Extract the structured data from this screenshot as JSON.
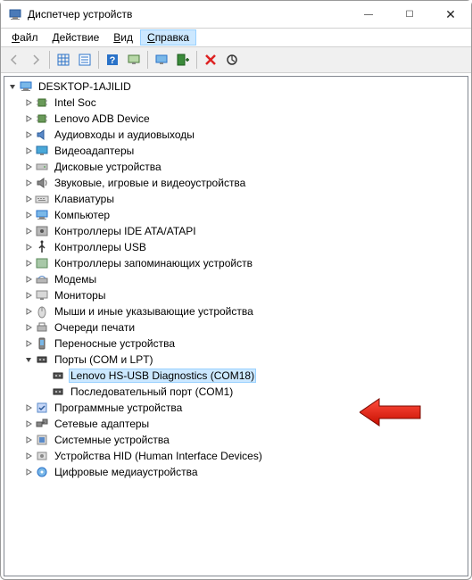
{
  "window": {
    "title": "Диспетчер устройств"
  },
  "menu": {
    "items": [
      {
        "label": "Файл",
        "accel": "Ф"
      },
      {
        "label": "Действие",
        "accel": "Д"
      },
      {
        "label": "Вид",
        "accel": "В"
      },
      {
        "label": "Справка",
        "accel": "С",
        "highlighted": true
      }
    ]
  },
  "toolbar": {
    "buttons": [
      {
        "name": "back-icon",
        "glyph": "arrow-left",
        "disabled": true
      },
      {
        "name": "forward-icon",
        "glyph": "arrow-right",
        "disabled": true
      },
      {
        "sep": true
      },
      {
        "name": "show-hidden-icon",
        "glyph": "grid"
      },
      {
        "name": "properties-icon",
        "glyph": "props"
      },
      {
        "sep": true
      },
      {
        "name": "help-icon",
        "glyph": "help"
      },
      {
        "name": "monitor-icon",
        "glyph": "monitor2"
      },
      {
        "sep": true
      },
      {
        "name": "scan-icon",
        "glyph": "monitor-scan"
      },
      {
        "name": "add-legacy-icon",
        "glyph": "add-hw"
      },
      {
        "sep": true
      },
      {
        "name": "remove-icon",
        "glyph": "red-x"
      },
      {
        "name": "update-icon",
        "glyph": "circle-arrow"
      }
    ]
  },
  "tree": {
    "root": {
      "label": "DESKTOP-1AJILID",
      "icon": "computer",
      "expanded": true
    },
    "categories": [
      {
        "label": "Intel Soc",
        "icon": "chip"
      },
      {
        "label": "Lenovo ADB Device",
        "icon": "chip"
      },
      {
        "label": "Аудиовходы и аудиовыходы",
        "icon": "audio"
      },
      {
        "label": "Видеоадаптеры",
        "icon": "display"
      },
      {
        "label": "Дисковые устройства",
        "icon": "disk"
      },
      {
        "label": "Звуковые, игровые и видеоустройства",
        "icon": "sound"
      },
      {
        "label": "Клавиатуры",
        "icon": "keyboard"
      },
      {
        "label": "Компьютер",
        "icon": "computer"
      },
      {
        "label": "Контроллеры IDE ATA/ATAPI",
        "icon": "ide"
      },
      {
        "label": "Контроллеры USB",
        "icon": "usb"
      },
      {
        "label": "Контроллеры запоминающих устройств",
        "icon": "storage"
      },
      {
        "label": "Модемы",
        "icon": "modem"
      },
      {
        "label": "Мониторы",
        "icon": "monitor"
      },
      {
        "label": "Мыши и иные указывающие устройства",
        "icon": "mouse"
      },
      {
        "label": "Очереди печати",
        "icon": "printer"
      },
      {
        "label": "Переносные устройства",
        "icon": "portable"
      },
      {
        "label": "Порты (COM и LPT)",
        "icon": "port",
        "expanded": true,
        "children": [
          {
            "label": "Lenovo HS-USB Diagnostics (COM18)",
            "icon": "port",
            "selected": true
          },
          {
            "label": "Последовательный порт (COM1)",
            "icon": "port"
          }
        ]
      },
      {
        "label": "Программные устройства",
        "icon": "software"
      },
      {
        "label": "Сетевые адаптеры",
        "icon": "network"
      },
      {
        "label": "Системные устройства",
        "icon": "system"
      },
      {
        "label": "Устройства HID (Human Interface Devices)",
        "icon": "hid"
      },
      {
        "label": "Цифровые медиаустройства",
        "icon": "media"
      }
    ]
  }
}
